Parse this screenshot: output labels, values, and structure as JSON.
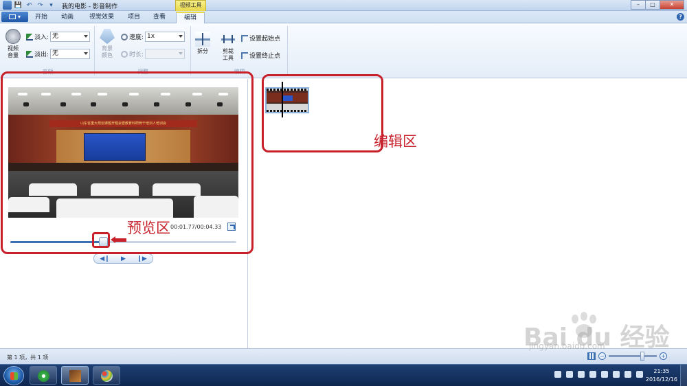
{
  "window": {
    "title": "我的电影 - 影音制作",
    "context_tab": "视频工具",
    "controls": [
      "–",
      "□",
      "✕"
    ]
  },
  "qat": [
    "💾",
    "↶",
    "↷",
    "▾"
  ],
  "tabs": {
    "file_label": "",
    "items": [
      {
        "label": "开始"
      },
      {
        "label": "动画"
      },
      {
        "label": "视觉效果"
      },
      {
        "label": "项目"
      },
      {
        "label": "查看"
      },
      {
        "label": "编辑",
        "active": true
      }
    ],
    "help": "?"
  },
  "ribbon": {
    "audio": {
      "group_label": "音频",
      "video_volume": "视频\n音量",
      "fade_in_label": "淡入:",
      "fade_in_value": "无",
      "fade_out_label": "淡出:",
      "fade_out_value": "无"
    },
    "adjust": {
      "group_label": "调整",
      "bg_color": "背景\n颜色",
      "speed_label": "速度:",
      "speed_value": "1x",
      "duration_label": "时长:",
      "duration_value": ""
    },
    "edit": {
      "group_label": "编辑",
      "split": "拆分",
      "trim": "剪裁\n工具",
      "set_start": "设置起始点",
      "set_end": "设置终止点"
    }
  },
  "preview": {
    "banner_text": "山东省重大规划课题开题会暨教育科研骨干培训人培训会",
    "time": "00:01.77/00:04.33",
    "progress": 0.41,
    "transport": [
      "◀❙",
      "▶",
      "❙▶"
    ]
  },
  "annotations": {
    "preview_label": "预览区",
    "edit_label": "编辑区",
    "color": "#c8202a"
  },
  "status": {
    "text": "第 1 项，共 1 项"
  },
  "watermark": {
    "text": "Bai du 经验",
    "sub": "jingyan.baidu.com"
  },
  "taskbar": {
    "time": "21:35",
    "date": "2016/12/16"
  },
  "colors": {
    "accent": "#2e64b0",
    "context_tab": "#e9d84c"
  }
}
